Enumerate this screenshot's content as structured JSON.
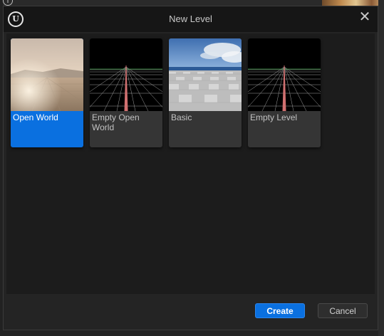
{
  "window": {
    "title": "New Level",
    "close_glyph": "✕",
    "logo_glyph": "U",
    "logo_icon": "unreal-engine-logo-icon"
  },
  "templates": [
    {
      "label": "Open World",
      "thumbnail": "open-world-thumbnail",
      "selected": true
    },
    {
      "label": "Empty Open World",
      "thumbnail": "empty-open-world-thumbnail",
      "selected": false
    },
    {
      "label": "Basic",
      "thumbnail": "basic-thumbnail",
      "selected": false
    },
    {
      "label": "Empty Level",
      "thumbnail": "empty-level-thumbnail",
      "selected": false
    }
  ],
  "buttons": {
    "create_label": "Create",
    "cancel_label": "Cancel"
  },
  "colors": {
    "accent": "#0a70e0",
    "dialog_bg": "#242424",
    "card_bg": "#353535"
  }
}
